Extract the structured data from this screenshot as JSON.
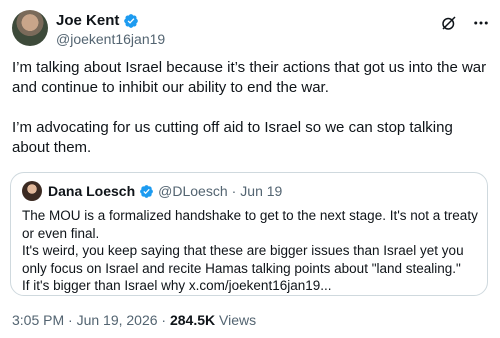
{
  "author": {
    "name": "Joe Kent",
    "handle": "@joekent16jan19"
  },
  "tweet": {
    "paragraph_1": "I’m talking about Israel because it’s their actions that got us into the war and continue to inhibit our ability to end the war.",
    "paragraph_2": "I’m advocating for us cutting off aid to Israel so we can stop talking about them."
  },
  "quoted": {
    "name": "Dana Loesch",
    "handle": "@DLoesch",
    "separator": "·",
    "date": "Jun 19",
    "line_1": "The MOU is a formalized handshake to get to the next stage. It's not a treaty or even final.",
    "line_2": "It's weird, you keep saying that these are bigger issues than Israel yet you only focus on Israel and recite Hamas talking points about \"land stealing.\"",
    "line_3": "If it's bigger than Israel why x.com/joekent16jan19..."
  },
  "footer": {
    "timestamp": "3:05 PM · Jun 19, 2026 · ",
    "views_count": "284.5K",
    "views_label": " Views"
  },
  "colors": {
    "verified": "#1d9bf0",
    "muted": "#536471",
    "border": "#cfd9de"
  },
  "icons": [
    "verified-badge-icon",
    "grok-icon",
    "more-icon"
  ]
}
